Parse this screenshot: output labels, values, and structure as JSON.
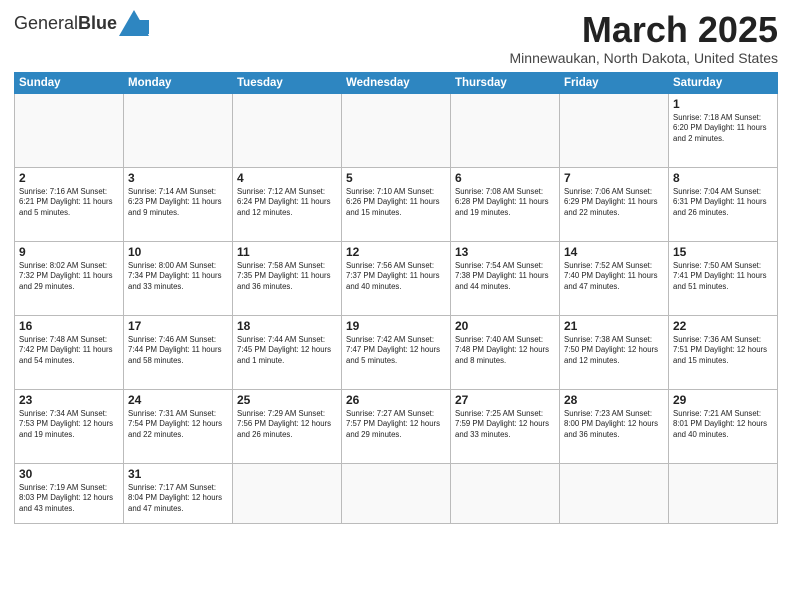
{
  "header": {
    "logo_text_regular": "General",
    "logo_text_bold": "Blue",
    "month_title": "March 2025",
    "location": "Minnewaukan, North Dakota, United States"
  },
  "weekdays": [
    "Sunday",
    "Monday",
    "Tuesday",
    "Wednesday",
    "Thursday",
    "Friday",
    "Saturday"
  ],
  "weeks": [
    [
      {
        "day": "",
        "info": ""
      },
      {
        "day": "",
        "info": ""
      },
      {
        "day": "",
        "info": ""
      },
      {
        "day": "",
        "info": ""
      },
      {
        "day": "",
        "info": ""
      },
      {
        "day": "",
        "info": ""
      },
      {
        "day": "1",
        "info": "Sunrise: 7:18 AM\nSunset: 6:20 PM\nDaylight: 11 hours\nand 2 minutes."
      }
    ],
    [
      {
        "day": "2",
        "info": "Sunrise: 7:16 AM\nSunset: 6:21 PM\nDaylight: 11 hours\nand 5 minutes."
      },
      {
        "day": "3",
        "info": "Sunrise: 7:14 AM\nSunset: 6:23 PM\nDaylight: 11 hours\nand 9 minutes."
      },
      {
        "day": "4",
        "info": "Sunrise: 7:12 AM\nSunset: 6:24 PM\nDaylight: 11 hours\nand 12 minutes."
      },
      {
        "day": "5",
        "info": "Sunrise: 7:10 AM\nSunset: 6:26 PM\nDaylight: 11 hours\nand 15 minutes."
      },
      {
        "day": "6",
        "info": "Sunrise: 7:08 AM\nSunset: 6:28 PM\nDaylight: 11 hours\nand 19 minutes."
      },
      {
        "day": "7",
        "info": "Sunrise: 7:06 AM\nSunset: 6:29 PM\nDaylight: 11 hours\nand 22 minutes."
      },
      {
        "day": "8",
        "info": "Sunrise: 7:04 AM\nSunset: 6:31 PM\nDaylight: 11 hours\nand 26 minutes."
      }
    ],
    [
      {
        "day": "9",
        "info": "Sunrise: 8:02 AM\nSunset: 7:32 PM\nDaylight: 11 hours\nand 29 minutes."
      },
      {
        "day": "10",
        "info": "Sunrise: 8:00 AM\nSunset: 7:34 PM\nDaylight: 11 hours\nand 33 minutes."
      },
      {
        "day": "11",
        "info": "Sunrise: 7:58 AM\nSunset: 7:35 PM\nDaylight: 11 hours\nand 36 minutes."
      },
      {
        "day": "12",
        "info": "Sunrise: 7:56 AM\nSunset: 7:37 PM\nDaylight: 11 hours\nand 40 minutes."
      },
      {
        "day": "13",
        "info": "Sunrise: 7:54 AM\nSunset: 7:38 PM\nDaylight: 11 hours\nand 44 minutes."
      },
      {
        "day": "14",
        "info": "Sunrise: 7:52 AM\nSunset: 7:40 PM\nDaylight: 11 hours\nand 47 minutes."
      },
      {
        "day": "15",
        "info": "Sunrise: 7:50 AM\nSunset: 7:41 PM\nDaylight: 11 hours\nand 51 minutes."
      }
    ],
    [
      {
        "day": "16",
        "info": "Sunrise: 7:48 AM\nSunset: 7:42 PM\nDaylight: 11 hours\nand 54 minutes."
      },
      {
        "day": "17",
        "info": "Sunrise: 7:46 AM\nSunset: 7:44 PM\nDaylight: 11 hours\nand 58 minutes."
      },
      {
        "day": "18",
        "info": "Sunrise: 7:44 AM\nSunset: 7:45 PM\nDaylight: 12 hours\nand 1 minute."
      },
      {
        "day": "19",
        "info": "Sunrise: 7:42 AM\nSunset: 7:47 PM\nDaylight: 12 hours\nand 5 minutes."
      },
      {
        "day": "20",
        "info": "Sunrise: 7:40 AM\nSunset: 7:48 PM\nDaylight: 12 hours\nand 8 minutes."
      },
      {
        "day": "21",
        "info": "Sunrise: 7:38 AM\nSunset: 7:50 PM\nDaylight: 12 hours\nand 12 minutes."
      },
      {
        "day": "22",
        "info": "Sunrise: 7:36 AM\nSunset: 7:51 PM\nDaylight: 12 hours\nand 15 minutes."
      }
    ],
    [
      {
        "day": "23",
        "info": "Sunrise: 7:34 AM\nSunset: 7:53 PM\nDaylight: 12 hours\nand 19 minutes."
      },
      {
        "day": "24",
        "info": "Sunrise: 7:31 AM\nSunset: 7:54 PM\nDaylight: 12 hours\nand 22 minutes."
      },
      {
        "day": "25",
        "info": "Sunrise: 7:29 AM\nSunset: 7:56 PM\nDaylight: 12 hours\nand 26 minutes."
      },
      {
        "day": "26",
        "info": "Sunrise: 7:27 AM\nSunset: 7:57 PM\nDaylight: 12 hours\nand 29 minutes."
      },
      {
        "day": "27",
        "info": "Sunrise: 7:25 AM\nSunset: 7:59 PM\nDaylight: 12 hours\nand 33 minutes."
      },
      {
        "day": "28",
        "info": "Sunrise: 7:23 AM\nSunset: 8:00 PM\nDaylight: 12 hours\nand 36 minutes."
      },
      {
        "day": "29",
        "info": "Sunrise: 7:21 AM\nSunset: 8:01 PM\nDaylight: 12 hours\nand 40 minutes."
      }
    ],
    [
      {
        "day": "30",
        "info": "Sunrise: 7:19 AM\nSunset: 8:03 PM\nDaylight: 12 hours\nand 43 minutes."
      },
      {
        "day": "31",
        "info": "Sunrise: 7:17 AM\nSunset: 8:04 PM\nDaylight: 12 hours\nand 47 minutes."
      },
      {
        "day": "",
        "info": ""
      },
      {
        "day": "",
        "info": ""
      },
      {
        "day": "",
        "info": ""
      },
      {
        "day": "",
        "info": ""
      },
      {
        "day": "",
        "info": ""
      }
    ]
  ]
}
